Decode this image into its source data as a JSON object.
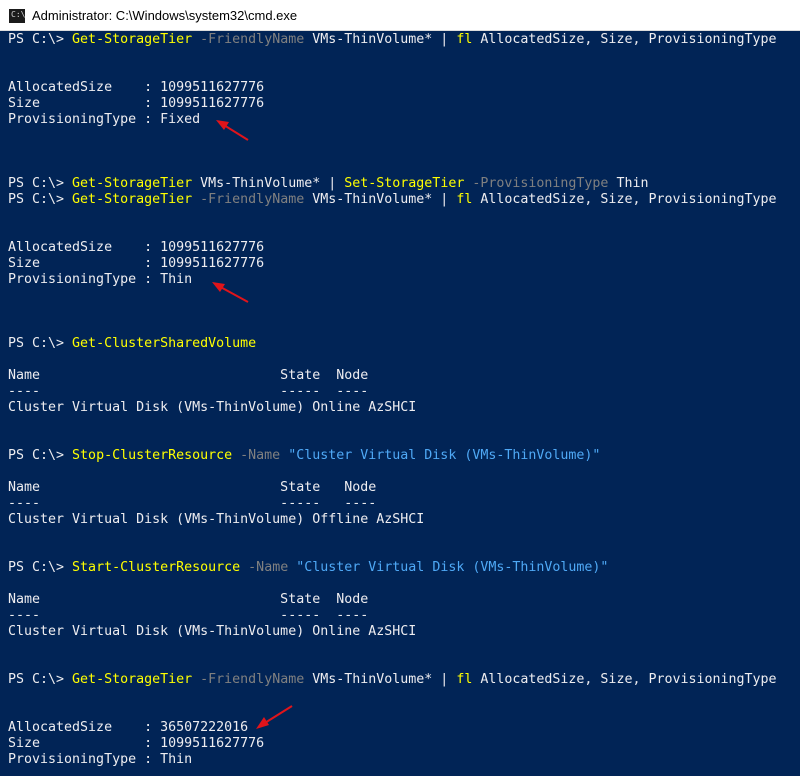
{
  "window": {
    "title": "Administrator: C:\\Windows\\system32\\cmd.exe",
    "icon": "cmd-icon",
    "icon_text": "C:\\"
  },
  "colors": {
    "background": "#012456",
    "text": "#eeedf0",
    "command": "#ffff00",
    "parameter": "#808080",
    "string": "#4fa9f6",
    "annotation_arrow": "#e0141a"
  },
  "console": {
    "cmd1": {
      "prompt": "PS C:\\> ",
      "command": "Get-StorageTier",
      "p1": " -FriendlyName",
      "arg1": " VMs-ThinVolume* | ",
      "alias": "fl",
      "rest": " AllocatedSize, Size, ProvisioningType"
    },
    "out1": {
      "l1": "AllocatedSize    : 1099511627776",
      "l2": "Size             : 1099511627776",
      "l3": "ProvisioningType : Fixed"
    },
    "cmd2": {
      "prompt": "PS C:\\> ",
      "command": "Get-StorageTier",
      "arg1": " VMs-ThinVolume* | ",
      "command2": "Set-StorageTier",
      "p1": " -ProvisioningType",
      "arg2": " Thin"
    },
    "cmd3": {
      "prompt": "PS C:\\> ",
      "command": "Get-StorageTier",
      "p1": " -FriendlyName",
      "arg1": " VMs-ThinVolume* | ",
      "alias": "fl",
      "rest": " AllocatedSize, Size, ProvisioningType"
    },
    "out3": {
      "l1": "AllocatedSize    : 1099511627776",
      "l2": "Size             : 1099511627776",
      "l3": "ProvisioningType : Thin"
    },
    "cmd4": {
      "prompt": "PS C:\\> ",
      "command": "Get-ClusterSharedVolume"
    },
    "out4": {
      "header": "Name                              State  Node",
      "sep": "----                              -----  ----",
      "row": "Cluster Virtual Disk (VMs-ThinVolume) Online AzSHCI"
    },
    "cmd5": {
      "prompt": "PS C:\\> ",
      "command": "Stop-ClusterResource",
      "p1": " -Name",
      "str": " \"Cluster Virtual Disk (VMs-ThinVolume)\""
    },
    "out5": {
      "header": "Name                              State   Node",
      "sep": "----                              -----   ----",
      "row": "Cluster Virtual Disk (VMs-ThinVolume) Offline AzSHCI"
    },
    "cmd6": {
      "prompt": "PS C:\\> ",
      "command": "Start-ClusterResource",
      "p1": " -Name",
      "str": " \"Cluster Virtual Disk (VMs-ThinVolume)\""
    },
    "out6": {
      "header": "Name                              State  Node",
      "sep": "----                              -----  ----",
      "row": "Cluster Virtual Disk (VMs-ThinVolume) Online AzSHCI"
    },
    "cmd7": {
      "prompt": "PS C:\\> ",
      "command": "Get-StorageTier",
      "p1": " -FriendlyName",
      "arg1": " VMs-ThinVolume* | ",
      "alias": "fl",
      "rest": " AllocatedSize, Size, ProvisioningType"
    },
    "out7": {
      "l1": "AllocatedSize    : 36507222016",
      "l2": "Size             : 1099511627776",
      "l3": "ProvisioningType : Thin"
    }
  }
}
